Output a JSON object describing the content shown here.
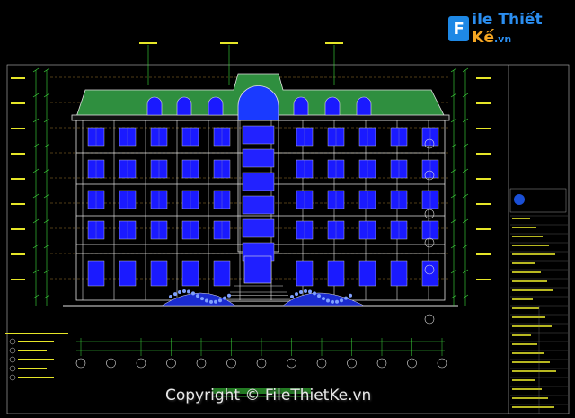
{
  "watermark": {
    "badge": "F",
    "name_part1": "ile",
    "name_part2": "Thiết",
    "name_part3": "Kế",
    "tld": ".vn"
  },
  "copyright": "Copyright © FileThietKe.vn",
  "colors": {
    "background": "#000000",
    "roof": "#2f8f3f",
    "window": "#1a1aff",
    "lines": "#e0e0e0",
    "dimension": "#3fe03f",
    "annotation": "#e6e628",
    "brand": "#2b8ef0"
  }
}
